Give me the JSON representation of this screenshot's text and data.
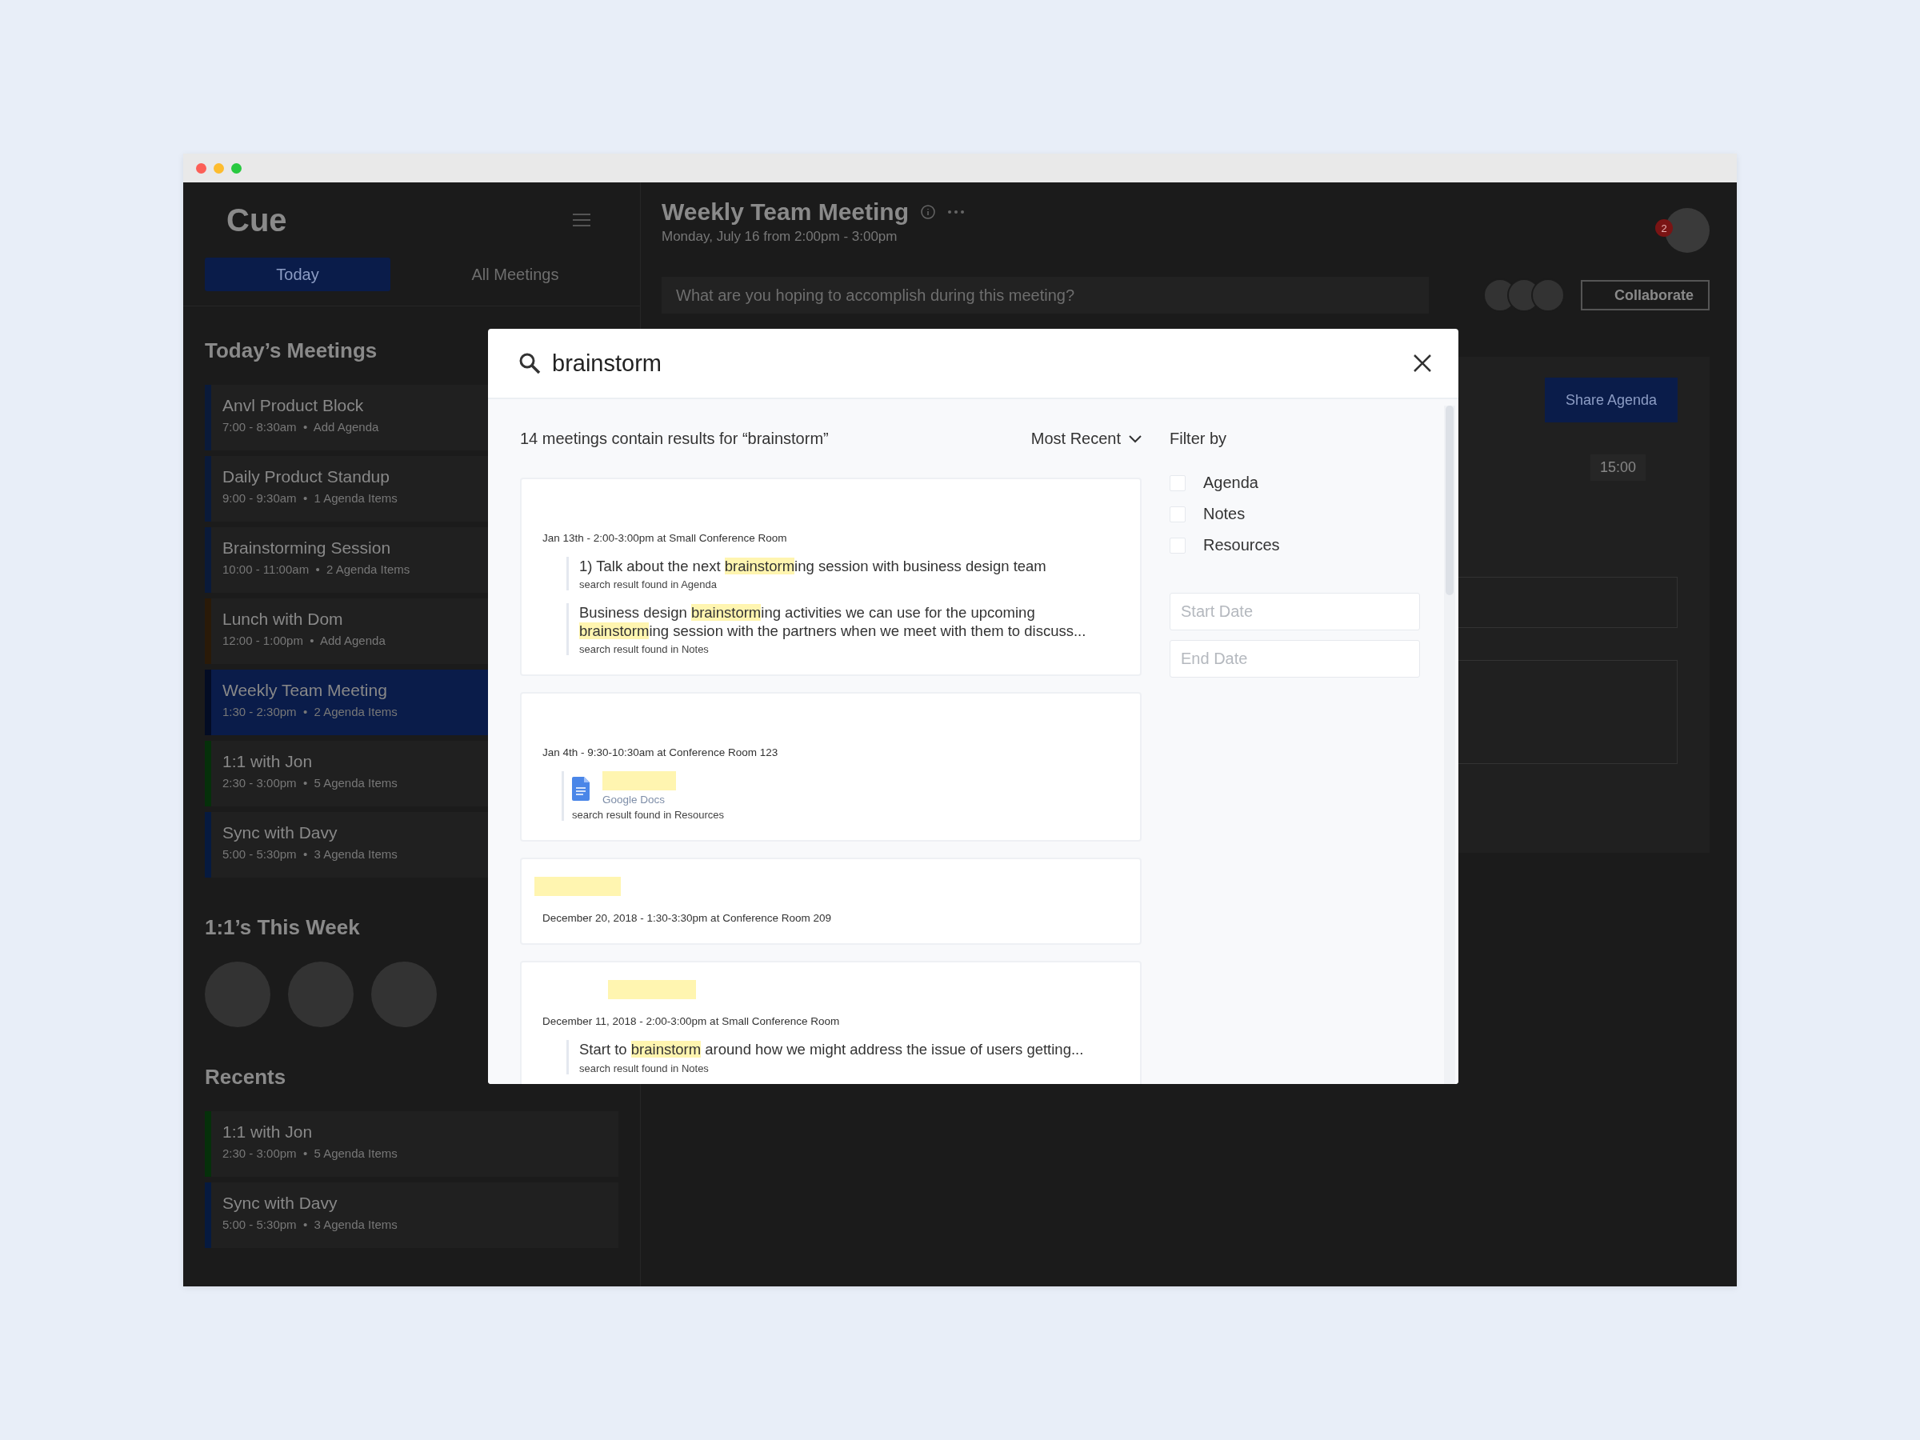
{
  "app": {
    "logo": "Cue",
    "tabs": [
      {
        "label": "Today",
        "selected": true
      },
      {
        "label": "All Meetings",
        "selected": false
      }
    ]
  },
  "sidebar": {
    "todays_meetings": {
      "heading": "Today’s Meetings",
      "items": [
        {
          "title": "Anvl Product Block",
          "meta": "7:00 - 8:30am  •  Add Agenda",
          "color": "#0a1a3a",
          "selected": false
        },
        {
          "title": "Daily Product Standup",
          "meta": "9:00 - 9:30am  •  1 Agenda Items",
          "color": "#0a1a3a",
          "selected": false
        },
        {
          "title": "Brainstorming Session",
          "meta": "10:00 - 11:00am  •  2 Agenda Items",
          "color": "#0a1a3a",
          "selected": false
        },
        {
          "title": "Lunch with Dom",
          "meta": "12:00 - 1:00pm  •  Add Agenda",
          "color": "#2a1a08",
          "selected": false
        },
        {
          "title": "Weekly Team Meeting",
          "meta": "1:30 - 2:30pm  •  2 Agenda Items",
          "color": "#030c24",
          "selected": true
        },
        {
          "title": "1:1 with Jon",
          "meta": "2:30 - 3:00pm  •  5 Agenda Items",
          "color": "#05300a",
          "selected": false
        },
        {
          "title": "Sync with Davy",
          "meta": "5:00 - 5:30pm  •  3 Agenda Items",
          "color": "#061a40",
          "selected": false
        }
      ]
    },
    "one_on_ones": {
      "heading": "1:1’s This Week"
    },
    "recents": {
      "heading": "Recents",
      "items": [
        {
          "title": "1:1 with Jon",
          "meta": "2:30 - 3:00pm  •  5 Agenda Items",
          "color": "#05300a",
          "selected": false
        },
        {
          "title": "Sync with Davy",
          "meta": "5:00 - 5:30pm  •  3 Agenda Items",
          "color": "#061a40",
          "selected": false
        }
      ]
    }
  },
  "meeting": {
    "title": "Weekly Team Meeting",
    "subtitle": "Monday, July 16 from 2:00pm - 3:00pm",
    "notification_count": "2",
    "goal_placeholder": "What are you hoping to accomplish during this meeting?",
    "collaborate": "Collaborate",
    "share": "Share Agenda",
    "timer": "15:00"
  },
  "search": {
    "query": "brainstorm",
    "summary": "14 meetings contain results for “brainstorm”",
    "sort": "Most Recent",
    "results": [
      {
        "title_highlight": false,
        "when": "Jan 13th - 2:00-3:00pm at Small Conference Room",
        "matches": [
          {
            "kind": "text",
            "segments": [
              {
                "text": "1) Talk about the next ",
                "highlight": false
              },
              {
                "text": "brainstorm",
                "highlight": true
              },
              {
                "text": "ing session with business design team",
                "highlight": false
              }
            ],
            "source": "search result found in Agenda"
          },
          {
            "kind": "text",
            "segments": [
              {
                "text": "Business design ",
                "highlight": false
              },
              {
                "text": "brainstorm",
                "highlight": true
              },
              {
                "text": "ing activities we can use for the upcoming ",
                "highlight": false
              },
              {
                "text": "brainstorm",
                "highlight": true
              },
              {
                "text": "ing session with the partners when we meet with them to discuss...",
                "highlight": false
              }
            ],
            "source": "search result found in Notes"
          }
        ]
      },
      {
        "title_highlight": false,
        "when": "Jan 4th - 9:30-10:30am at Conference Room 123",
        "matches": [
          {
            "kind": "resource",
            "provider": "Google Docs",
            "source": "search result found in Resources"
          }
        ]
      },
      {
        "title_highlight": true,
        "when": "December 20, 2018 - 1:30-3:30pm at Conference Room 209"
      },
      {
        "title_highlight": true,
        "when": "December 11, 2018 - 2:00-3:00pm at Small Conference Room",
        "matches": [
          {
            "kind": "text",
            "segments": [
              {
                "text": "Start to ",
                "highlight": false
              },
              {
                "text": "brainstorm",
                "highlight": true
              },
              {
                "text": " around how we might address the issue of users getting...",
                "highlight": false
              }
            ],
            "source": "search result found in Notes"
          }
        ]
      }
    ],
    "filter": {
      "heading": "Filter by",
      "options": [
        {
          "label": "Agenda",
          "checked": false
        },
        {
          "label": "Notes",
          "checked": false
        },
        {
          "label": "Resources",
          "checked": false
        }
      ],
      "start_placeholder": "Start Date",
      "end_placeholder": "End Date"
    }
  }
}
